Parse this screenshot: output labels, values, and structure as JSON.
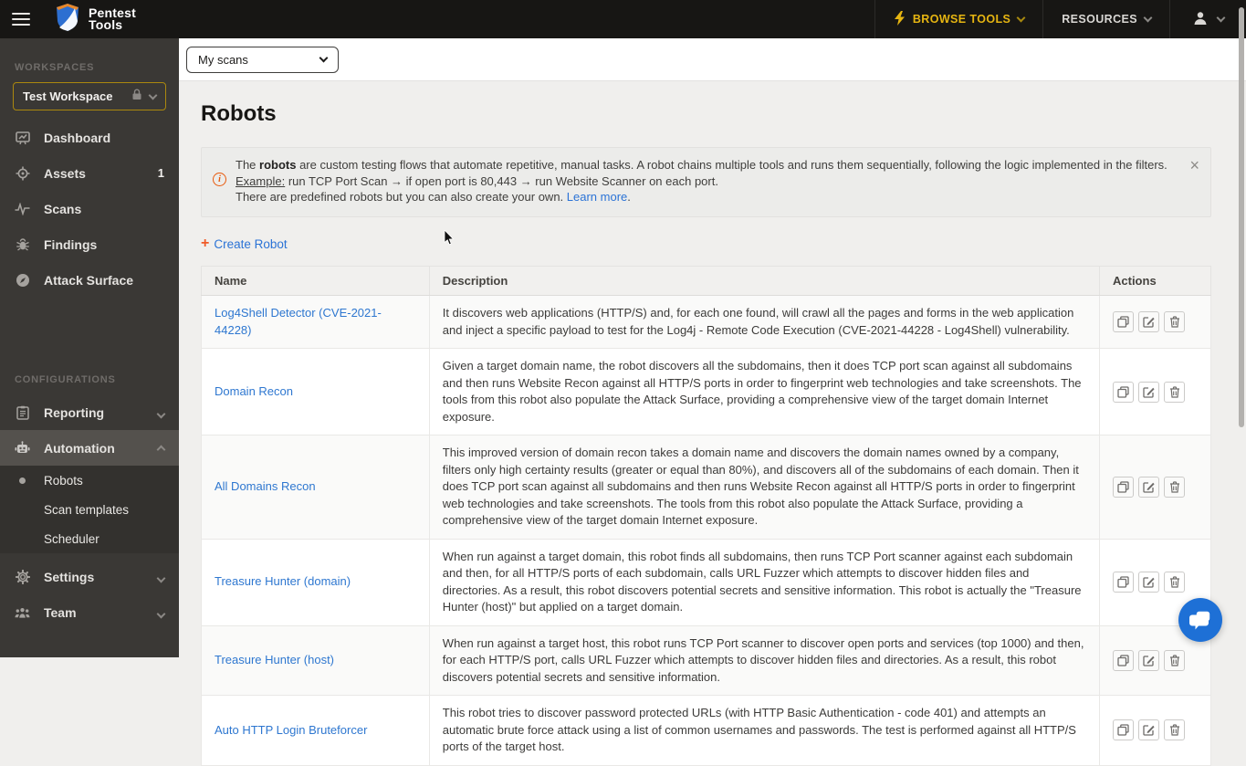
{
  "colors": {
    "navbar_bg": "#171614",
    "accent_yellow": "#e6b511",
    "sidebar_bg": "#3a3835",
    "workspace_border": "#ab880e",
    "link_blue": "#2e77d0",
    "orange": "#f05a28",
    "info_orange": "#e8590c",
    "chat_blue": "#1e70d6",
    "page_bg": "#f0efed"
  },
  "navbar": {
    "logo_line1": "Pentest",
    "logo_line2": "Tools",
    "browse_tools_label": "BROWSE TOOLS",
    "resources_label": "RESOURCES"
  },
  "sidebar": {
    "workspaces_label": "WORKSPACES",
    "workspace_name": "Test Workspace",
    "items": [
      {
        "label": "Dashboard"
      },
      {
        "label": "Assets",
        "badge": "1"
      },
      {
        "label": "Scans"
      },
      {
        "label": "Findings"
      },
      {
        "label": "Attack Surface"
      }
    ],
    "configurations_label": "CONFIGURATIONS",
    "reporting_label": "Reporting",
    "automation_label": "Automation",
    "automation_children": [
      {
        "label": "Robots",
        "active": true
      },
      {
        "label": "Scan templates",
        "active": false
      },
      {
        "label": "Scheduler",
        "active": false
      }
    ],
    "settings_label": "Settings",
    "team_label": "Team"
  },
  "topbar": {
    "scans_dropdown_value": "My scans"
  },
  "page": {
    "title": "Robots",
    "banner": {
      "line1_pre": "The ",
      "line1_bold": "robots",
      "line1_rest": " are custom testing flows that automate repetitive, manual tasks. A robot chains multiple tools and runs them sequentially, following the logic implemented in the filters.",
      "line2_label": "Example:",
      "line2_rest": " run TCP Port Scan → if open port is 80,443 → run Website Scanner on each port.",
      "line3_pre": "There are predefined robots but you can also create your own. ",
      "line3_link": "Learn more",
      "line3_end": ".",
      "close_glyph": "×"
    },
    "create_robot": {
      "plus_glyph": "+",
      "label": "Create Robot"
    },
    "table": {
      "headers": [
        "Name",
        "Description",
        "Actions"
      ],
      "rows": [
        {
          "name": "Log4Shell Detector (CVE-2021-44228)",
          "description": "It discovers web applications (HTTP/S) and, for each one found, will crawl all the pages and forms in the web application and inject a specific payload to test for the Log4j - Remote Code Execution (CVE-2021-44228 - Log4Shell) vulnerability."
        },
        {
          "name": "Domain Recon",
          "description": "Given a target domain name, the robot discovers all the subdomains, then it does TCP port scan against all subdomains and then runs Website Recon against all HTTP/S ports in order to fingerprint web technologies and take screenshots. The tools from this robot also populate the Attack Surface, providing a comprehensive view of the target domain Internet exposure."
        },
        {
          "name": "All Domains Recon",
          "description": "This improved version of domain recon takes a domain name and discovers the domain names owned by a company, filters only high certainty results (greater or equal than 80%), and discovers all of the subdomains of each domain. Then it does TCP port scan against all subdomains and then runs Website Recon against all HTTP/S ports in order to fingerprint web technologies and take screenshots. The tools from this robot also populate the Attack Surface, providing a comprehensive view of the target domain Internet exposure."
        },
        {
          "name": "Treasure Hunter (domain)",
          "description": "When run against a target domain, this robot finds all subdomains, then runs TCP Port scanner against each subdomain and then, for all HTTP/S ports of each subdomain, calls URL Fuzzer which attempts to discover hidden files and directories. As a result, this robot discovers potential secrets and sensitive information. This robot is actually the \"Treasure Hunter (host)\" but applied on a target domain."
        },
        {
          "name": "Treasure Hunter (host)",
          "description": "When run against a target host, this robot runs TCP Port scanner to discover open ports and services (top 1000) and then, for each HTTP/S port, calls URL Fuzzer which attempts to discover hidden files and directories. As a result, this robot discovers potential secrets and sensitive information."
        },
        {
          "name": "Auto HTTP Login Bruteforcer",
          "description": "This robot tries to discover password protected URLs (with HTTP Basic Authentication - code 401) and attempts an automatic brute force attack using a list of common usernames and passwords. The test is performed against all HTTP/S ports of the target host."
        }
      ]
    }
  }
}
